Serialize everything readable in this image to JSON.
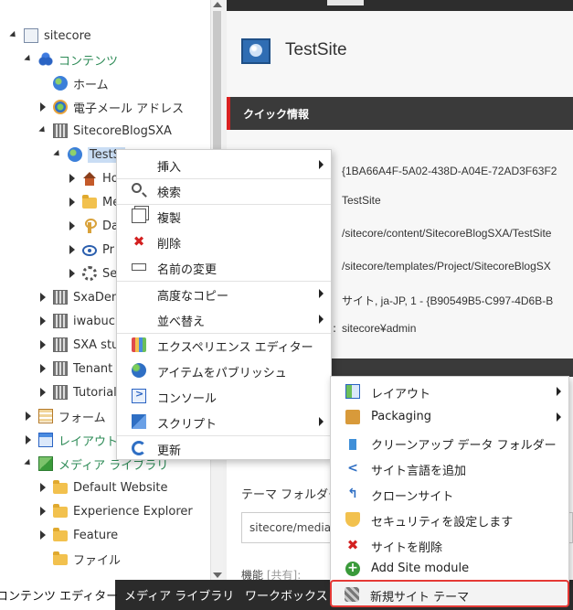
{
  "tree": {
    "items": [
      {
        "label": "sitecore",
        "green": false
      },
      {
        "label": "コンテンツ",
        "green": true
      },
      {
        "label": "ホーム",
        "green": false
      },
      {
        "label": "電子メール アドレス",
        "green": false
      },
      {
        "label": "SitecoreBlogSXA",
        "green": false
      },
      {
        "label": "TestSi",
        "green": false
      },
      {
        "label": "Ho",
        "green": false
      },
      {
        "label": "Me",
        "green": false
      },
      {
        "label": "Da",
        "green": false
      },
      {
        "label": "Pr",
        "green": false
      },
      {
        "label": "Se",
        "green": false
      },
      {
        "label": "SxaDem",
        "green": false
      },
      {
        "label": "iwabuch",
        "green": false
      },
      {
        "label": "SXA stu",
        "green": false
      },
      {
        "label": "Tenant",
        "green": false
      },
      {
        "label": "Tutorial",
        "green": false
      },
      {
        "label": "フォーム",
        "green": false
      },
      {
        "label": "レイアウト",
        "green": true
      },
      {
        "label": "メディア ライブラリ",
        "green": true
      },
      {
        "label": "Default Website",
        "green": false
      },
      {
        "label": "Experience Explorer",
        "green": false
      },
      {
        "label": "Feature",
        "green": false
      },
      {
        "label": "ファイル",
        "green": false
      }
    ]
  },
  "editor": {
    "site_title": "TestSite",
    "quick_info_header": "クイック情報",
    "quick_values": [
      "{1BA66A4F-5A02-438D-A04E-72AD3F63F2",
      "TestSite",
      "/sitecore/content/SitecoreBlogSXA/TestSite",
      "/sitecore/templates/Project/SitecoreBlogSX",
      "サイト, ja-JP, 1 - {B90549B5-C997-4D6B-B",
      "sitecore¥admin"
    ],
    "colon": ":",
    "theme_folder_label": "テーマ フォルダー",
    "theme_folder_value": "sitecore/media",
    "func_label": "機能",
    "func_shared": "[共有]:"
  },
  "context_menu": {
    "items": [
      {
        "label": "挿入",
        "icon": "blank-icon",
        "sub": true
      },
      {
        "label": "検索",
        "icon": "search-icon",
        "sub": false
      },
      {
        "label": "複製",
        "icon": "copy-icon",
        "sub": false
      },
      {
        "label": "削除",
        "icon": "delete-icon",
        "sub": false
      },
      {
        "label": "名前の変更",
        "icon": "rename-icon",
        "sub": false
      },
      {
        "label": "高度なコピー",
        "icon": "blank-icon",
        "sub": true
      },
      {
        "label": "並べ替え",
        "icon": "blank-icon",
        "sub": true
      },
      {
        "label": "エクスペリエンス エディター",
        "icon": "experience-editor-icon",
        "sub": false
      },
      {
        "label": "アイテムをパブリッシュ",
        "icon": "publish-icon",
        "sub": false
      },
      {
        "label": "コンソール",
        "icon": "console-icon",
        "sub": false
      },
      {
        "label": "スクリプト",
        "icon": "script-icon",
        "sub": true
      },
      {
        "label": "更新",
        "icon": "refresh-icon",
        "sub": false
      }
    ]
  },
  "script_submenu": {
    "items": [
      {
        "label": "レイアウト",
        "icon": "layout-icon",
        "sub": true
      },
      {
        "label": "Packaging",
        "icon": "package-icon",
        "sub": true
      },
      {
        "label": "クリーンアップ データ フォルダー",
        "icon": "cleanup-icon",
        "sub": false
      },
      {
        "label": "サイト言語を追加",
        "icon": "share-icon",
        "sub": false
      },
      {
        "label": "クローンサイト",
        "icon": "clone-icon",
        "sub": false
      },
      {
        "label": "セキュリティを設定します",
        "icon": "shield-icon",
        "sub": false
      },
      {
        "label": "サイトを削除",
        "icon": "delete-icon",
        "sub": false
      },
      {
        "label": "Add Site module",
        "icon": "add-icon",
        "sub": false
      },
      {
        "label": "新規サイト テーマ",
        "icon": "theme-icon",
        "sub": false
      }
    ]
  },
  "bottom_tabs": [
    {
      "label": "コンテンツ エディター",
      "active": true
    },
    {
      "label": "メディア ライブラリ",
      "active": false
    },
    {
      "label": "ワークボックス",
      "active": false
    }
  ],
  "colors": {
    "accent_red": "#d92020",
    "selection": "#c9ddf4",
    "dark_bar": "#3a3a3a"
  }
}
